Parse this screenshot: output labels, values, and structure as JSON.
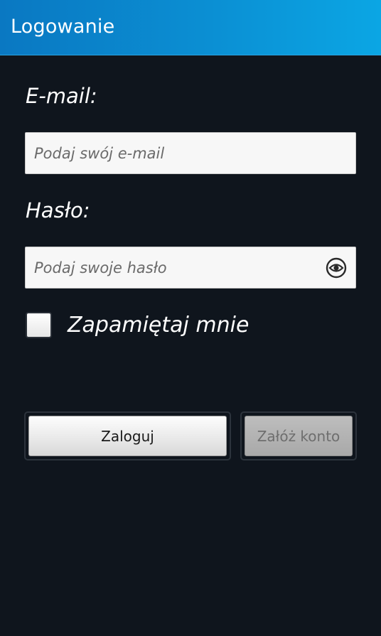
{
  "titlebar": {
    "title": "Logowanie",
    "accent_color": "#0b8fd3"
  },
  "form": {
    "email": {
      "label": "E-mail:",
      "placeholder": "Podaj swój e-mail",
      "value": ""
    },
    "password": {
      "label": "Hasło:",
      "placeholder": "Podaj swoje hasło",
      "value": "",
      "toggle_icon": "eye-icon"
    },
    "remember": {
      "label": "Zapamiętaj mnie",
      "checked": false
    }
  },
  "buttons": {
    "login_label": "Zaloguj",
    "register_label": "Załóż konto",
    "register_enabled": false
  }
}
